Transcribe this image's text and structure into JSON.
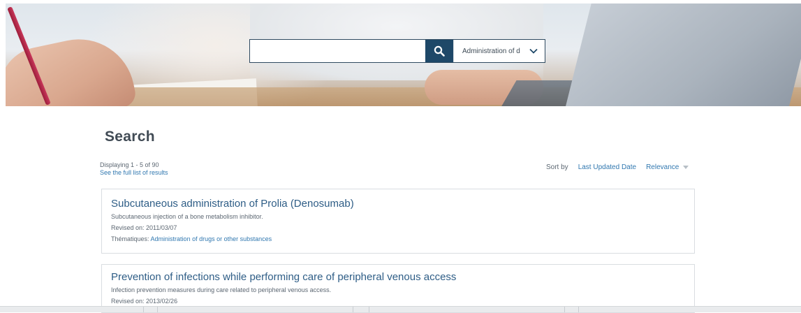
{
  "search": {
    "query": "",
    "scope_selected": "Administration of d"
  },
  "page": {
    "title": "Search",
    "displaying": "Displaying 1 - 5 of 90",
    "full_list_link": "See the full list of results"
  },
  "sort": {
    "label": "Sort by",
    "options": [
      "Last Updated Date",
      "Relevance"
    ]
  },
  "results": [
    {
      "title": "Subcutaneous administration of Prolia (Denosumab)",
      "description": "Subcutaneous injection of a bone metabolism inhibitor.",
      "revised": "Revised on: 2011/03/07",
      "themes_label": "Thématiques:",
      "themes_link": "Administration of drugs or other substances"
    },
    {
      "title": "Prevention of infections while performing care of peripheral venous access",
      "description": "Infection prevention measures during care related to peripheral venous access.",
      "revised": "Revised on: 2013/02/26"
    }
  ],
  "colors": {
    "accent": "#1e4868",
    "link": "#3178b0",
    "title_link": "#2e5d86"
  },
  "icons": {
    "search": "search-icon",
    "dropdown": "chevron-down-icon",
    "sort": "caret-down-icon"
  }
}
